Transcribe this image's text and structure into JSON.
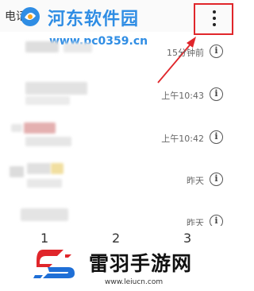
{
  "app": {
    "title": "电话"
  },
  "watermark_top": {
    "text": "河东软件园",
    "url": "www.pc0359.cn"
  },
  "calls": [
    {
      "time": "15分钟前"
    },
    {
      "time": "上午10:43"
    },
    {
      "time": "上午10:42"
    },
    {
      "time": "昨天"
    },
    {
      "time": "昨天"
    }
  ],
  "info_icon_glyph": "i",
  "dialpad": {
    "keys": [
      "1",
      "2",
      "3"
    ]
  },
  "watermark_bottom": {
    "text": "雷羽手游网",
    "url": "www.leiucn.com"
  },
  "colors": {
    "accent_blue": "#2f8de4",
    "highlight_red": "#e0262b"
  },
  "icons": [
    "menu-icon",
    "info-icon",
    "arrow-annotation"
  ]
}
